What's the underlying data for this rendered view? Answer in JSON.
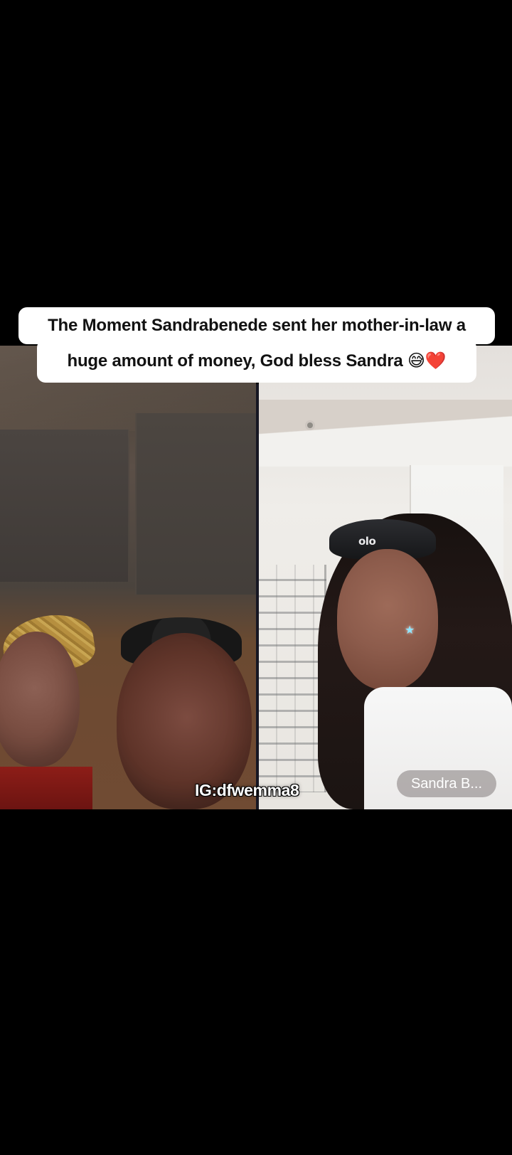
{
  "caption": {
    "line_1": "The Moment Sandrabenede sent her mother-in-law a",
    "line_2_text": "huge amount of money, God bless Sandra ",
    "emoji_1": "😅",
    "emoji_2": "❤️"
  },
  "overlay": {
    "watermark": "IG:dfwemma8",
    "participant_name": "Sandra B..."
  },
  "scene": {
    "headband_logo": "olo"
  },
  "colors": {
    "background": "#000000",
    "caption_background": "#ffffff",
    "caption_text": "#121212",
    "watermark_text": "#ffffff",
    "participant_pill": "#9a9595"
  }
}
